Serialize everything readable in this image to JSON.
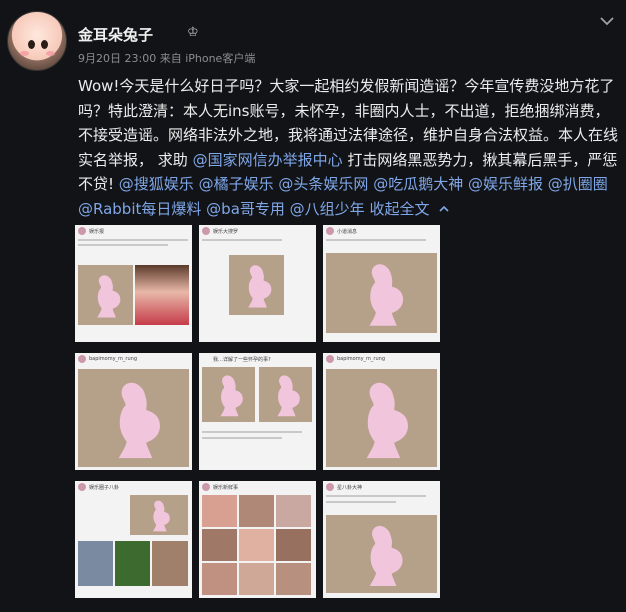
{
  "user": {
    "name": "金耳朵兔子",
    "timestamp": "9月20日 23:00",
    "source": "来自 iPhone客户端"
  },
  "post": {
    "text_main": "Wow!今天是什么好日子吗？大家一起相约发假新闻造谣？今年宣传费没地方花了吗？特此澄清：本人无ins账号，未怀孕，非圈内人士，不出道，拒绝捆绑消费，不接受造谣。网络非法外之地，我将通过法律途径，维护自身合法权益。本人在线实名举报， 求助",
    "mention_1": "@国家网信办举报中心",
    "text_mid": " 打击网络黑恶势力，揪其幕后黑手，严惩不贷!",
    "mentions_tail": [
      "@搜狐娱乐",
      "@橘子娱乐",
      "@头条娱乐网",
      "@吃瓜鹅大神",
      "@娱乐鲜报",
      "@扒圈圈",
      "@Rabbit每日爆料",
      "@ba哥专用",
      "@八组少年"
    ],
    "collapse_label": "收起全文"
  },
  "images": [
    {
      "caption": "娱乐报",
      "kind": "split"
    },
    {
      "caption": "娱乐大搜罗",
      "kind": "preg_center"
    },
    {
      "caption": "小道消息",
      "kind": "preg_only"
    },
    {
      "caption": "bapimomy_m_rung",
      "kind": "preg_full"
    },
    {
      "caption": "我…详解了一些怀孕的事?",
      "kind": "double"
    },
    {
      "caption": "bapimomy_m_rung",
      "kind": "preg_full"
    },
    {
      "caption": "娱乐圈子八卦",
      "kind": "photos"
    },
    {
      "caption": "娱乐新鲜事",
      "kind": "photo_grid"
    },
    {
      "caption": "星八卦大神",
      "kind": "preg_lower"
    }
  ],
  "colors": {
    "background": "#121317",
    "mention": "#7fa7e8",
    "pregnant_card": "#b5a08a",
    "silhouette": "#f1c6dc"
  },
  "icons": {
    "expand": "chevron-down-icon",
    "badge": "crown-icon"
  }
}
